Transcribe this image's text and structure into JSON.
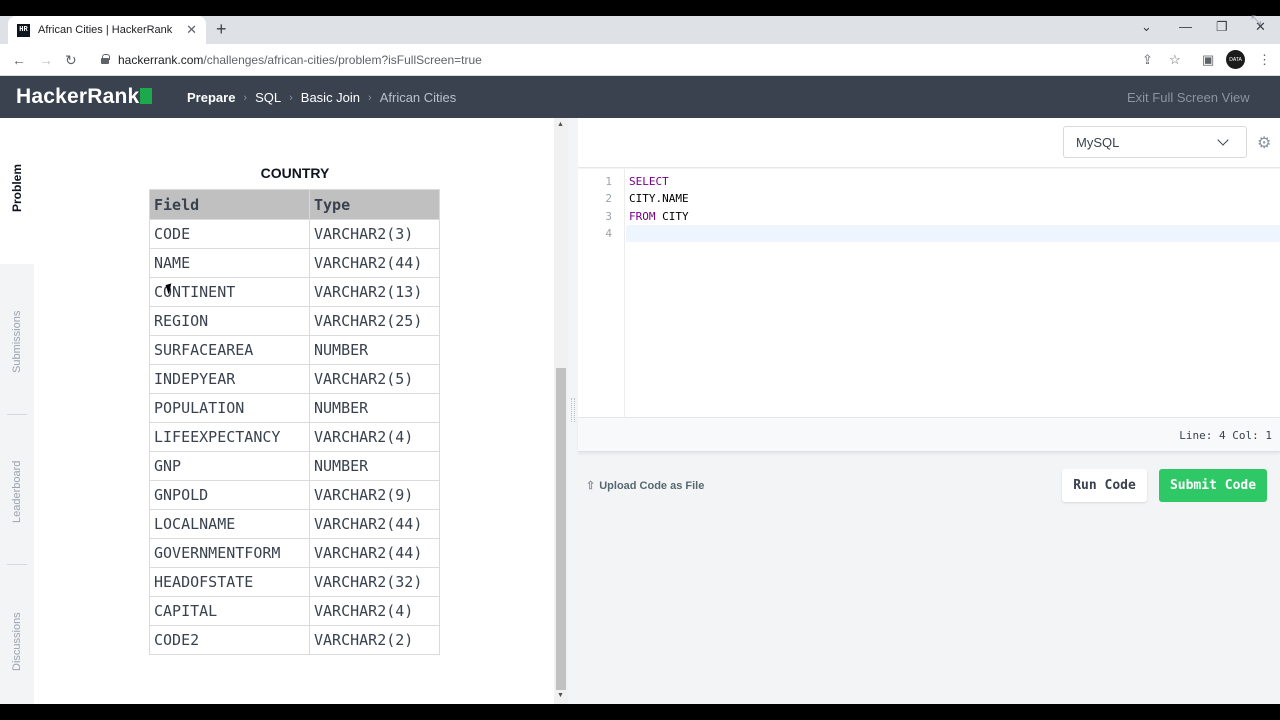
{
  "browser": {
    "tab_title": "African Cities | HackerRank",
    "favicon_text": "HR",
    "url_host": "hackerrank.com",
    "url_path": "/challenges/african-cities/problem?isFullScreen=true",
    "avatar_text": "DATA"
  },
  "header": {
    "logo": "HackerRank",
    "breadcrumbs": [
      "Prepare",
      "SQL",
      "Basic Join",
      "African Cities"
    ],
    "exit_fullscreen": "Exit Full Screen View"
  },
  "sidebar": {
    "tabs": [
      "Problem",
      "Submissions",
      "Leaderboard",
      "Discussions"
    ]
  },
  "problem": {
    "table_caption": "COUNTRY",
    "columns": [
      "Field",
      "Type"
    ],
    "rows": [
      [
        "CODE",
        "VARCHAR2(3)"
      ],
      [
        "NAME",
        "VARCHAR2(44)"
      ],
      [
        "CONTINENT",
        "VARCHAR2(13)"
      ],
      [
        "REGION",
        "VARCHAR2(25)"
      ],
      [
        "SURFACEAREA",
        "NUMBER"
      ],
      [
        "INDEPYEAR",
        "VARCHAR2(5)"
      ],
      [
        "POPULATION",
        "NUMBER"
      ],
      [
        "LIFEEXPECTANCY",
        "VARCHAR2(4)"
      ],
      [
        "GNP",
        "NUMBER"
      ],
      [
        "GNPOLD",
        "VARCHAR2(9)"
      ],
      [
        "LOCALNAME",
        "VARCHAR2(44)"
      ],
      [
        "GOVERNMENTFORM",
        "VARCHAR2(44)"
      ],
      [
        "HEADOFSTATE",
        "VARCHAR2(32)"
      ],
      [
        "CAPITAL",
        "VARCHAR2(4)"
      ],
      [
        "CODE2",
        "VARCHAR2(2)"
      ]
    ]
  },
  "editor": {
    "language": "MySQL",
    "line_numbers": [
      "1",
      "2",
      "3",
      "4"
    ],
    "code": {
      "line1_kw": "SELECT",
      "line2": "CITY.NAME",
      "line3_kw": "FROM",
      "line3_rest": " CITY",
      "line4": ""
    },
    "status": "Line: 4 Col: 1",
    "upload_label": "Upload Code as File",
    "run_label": "Run Code",
    "submit_label": "Submit Code"
  },
  "colors": {
    "header_bg": "#39424e",
    "brand_green": "#1ba94c",
    "submit_green": "#2ec866"
  }
}
